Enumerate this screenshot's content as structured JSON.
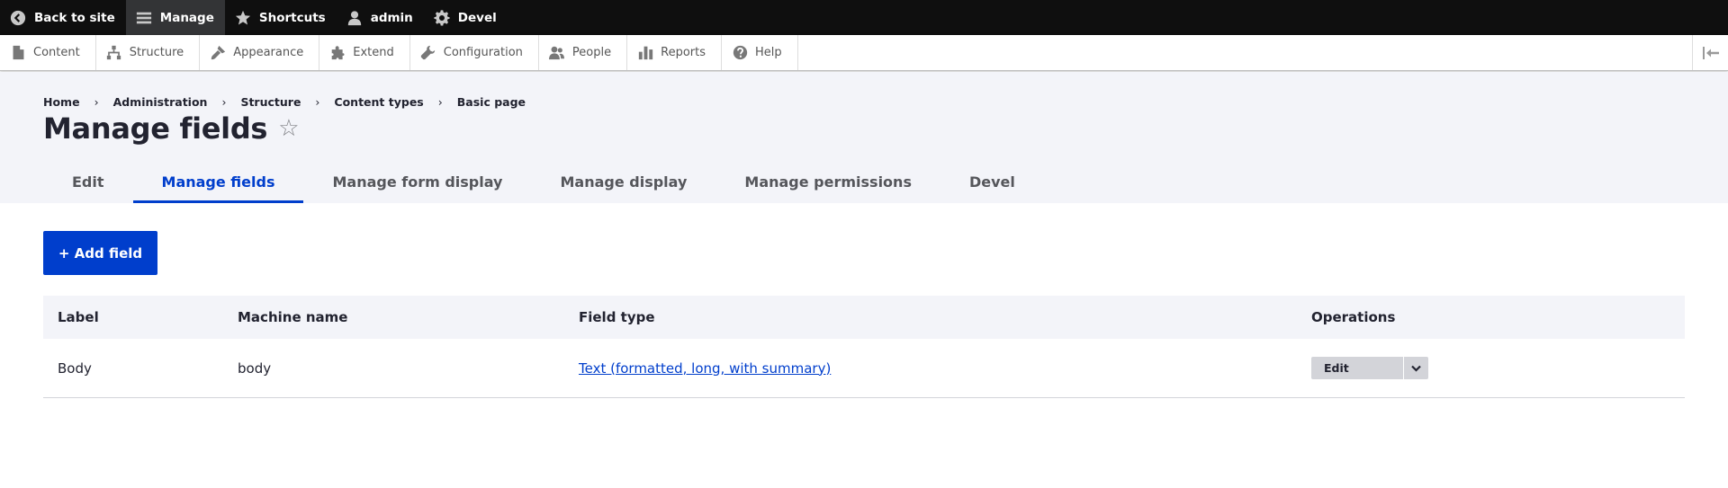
{
  "toolbar": {
    "items": [
      {
        "label": "Back to site",
        "icon": "back-arrow-icon"
      },
      {
        "label": "Manage",
        "icon": "hamburger-menu-icon"
      },
      {
        "label": "Shortcuts",
        "icon": "star-icon"
      },
      {
        "label": "admin",
        "icon": "user-icon"
      },
      {
        "label": "Devel",
        "icon": "gear-icon"
      }
    ]
  },
  "tray": {
    "items": [
      {
        "label": "Content",
        "icon": "document-icon"
      },
      {
        "label": "Structure",
        "icon": "sitemap-icon"
      },
      {
        "label": "Appearance",
        "icon": "paintbrush-icon"
      },
      {
        "label": "Extend",
        "icon": "puzzle-icon"
      },
      {
        "label": "Configuration",
        "icon": "wrench-icon"
      },
      {
        "label": "People",
        "icon": "people-icon"
      },
      {
        "label": "Reports",
        "icon": "bar-chart-icon"
      },
      {
        "label": "Help",
        "icon": "help-icon"
      }
    ]
  },
  "breadcrumb": [
    "Home",
    "Administration",
    "Structure",
    "Content types",
    "Basic page"
  ],
  "page": {
    "title": "Manage fields",
    "star": "☆"
  },
  "tabs": [
    {
      "label": "Edit",
      "active": false
    },
    {
      "label": "Manage fields",
      "active": true
    },
    {
      "label": "Manage form display",
      "active": false
    },
    {
      "label": "Manage display",
      "active": false
    },
    {
      "label": "Manage permissions",
      "active": false
    },
    {
      "label": "Devel",
      "active": false
    }
  ],
  "actions": {
    "add_field_label": "+ Add field"
  },
  "table": {
    "headers": [
      "Label",
      "Machine name",
      "Field type",
      "Operations"
    ],
    "rows": [
      {
        "label": "Body",
        "machine_name": "body",
        "field_type": "Text (formatted, long, with summary)",
        "operation": "Edit"
      }
    ]
  },
  "colors": {
    "accent": "#003ecc",
    "toolbar_bg": "#0f0f0f",
    "header_bg": "#f3f4f9"
  }
}
